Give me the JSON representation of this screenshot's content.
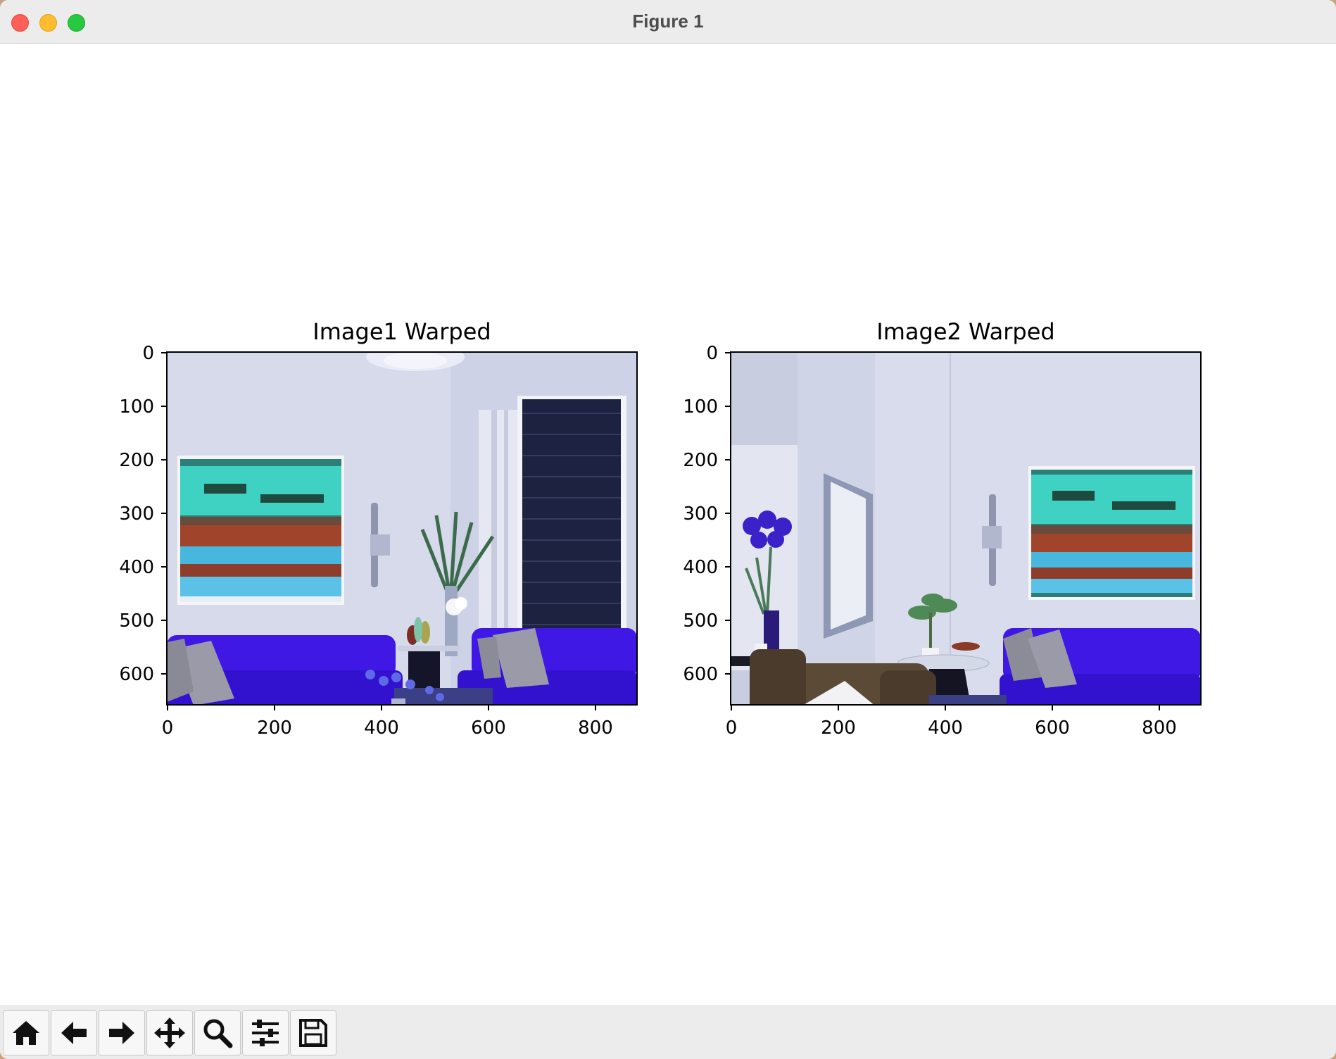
{
  "window": {
    "title": "Figure 1"
  },
  "figure": {
    "panels": [
      {
        "title": "Image1 Warped",
        "xticks": [
          "0",
          "200",
          "400",
          "600",
          "800"
        ],
        "yticks": [
          "0",
          "100",
          "200",
          "300",
          "400",
          "500",
          "600"
        ]
      },
      {
        "title": "Image2 Warped",
        "xticks": [
          "0",
          "200",
          "400",
          "600",
          "800"
        ],
        "yticks": [
          "0",
          "100",
          "200",
          "300",
          "400",
          "500",
          "600"
        ]
      }
    ]
  },
  "toolbar": {
    "tools": [
      {
        "name": "home",
        "icon": "home-icon"
      },
      {
        "name": "back",
        "icon": "arrow-left-icon"
      },
      {
        "name": "forward",
        "icon": "arrow-right-icon"
      },
      {
        "name": "pan",
        "icon": "move-icon"
      },
      {
        "name": "zoom",
        "icon": "magnifier-icon"
      },
      {
        "name": "configure-subplots",
        "icon": "sliders-icon"
      },
      {
        "name": "save",
        "icon": "floppy-disk-icon"
      }
    ]
  },
  "colors": {
    "sofa": "#3b16e0",
    "wall": "#d8dceb",
    "painting_teal": "#3fd2c2",
    "painting_rust": "#a0452c"
  }
}
